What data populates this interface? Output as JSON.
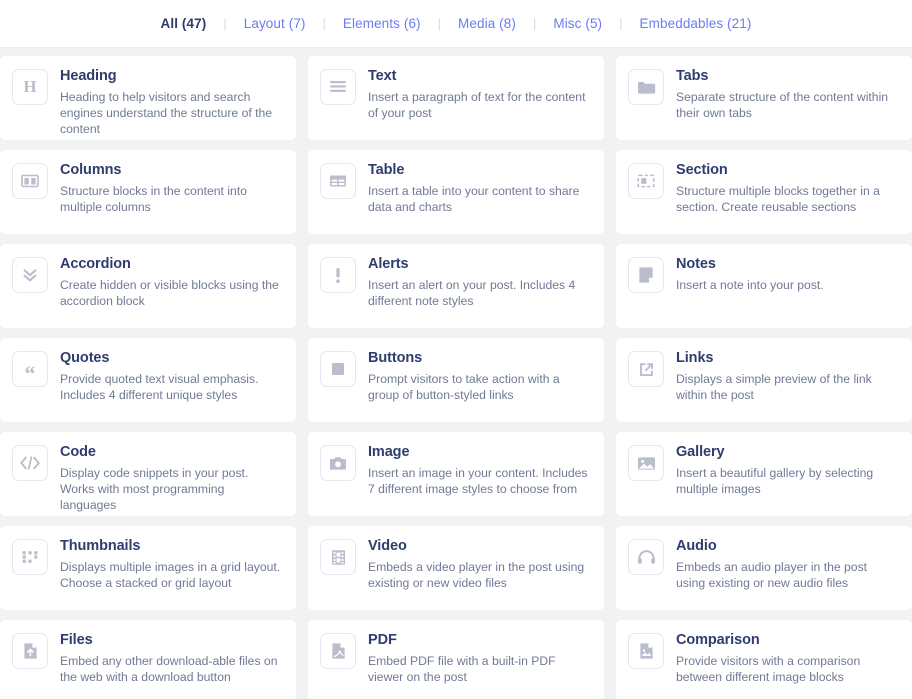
{
  "filters": {
    "separator": "|",
    "tabs": [
      {
        "label": "All (47)",
        "active": true
      },
      {
        "label": "Layout (7)",
        "active": false
      },
      {
        "label": "Elements (6)",
        "active": false
      },
      {
        "label": "Media (8)",
        "active": false
      },
      {
        "label": "Misc (5)",
        "active": false
      },
      {
        "label": "Embeddables (21)",
        "active": false
      }
    ]
  },
  "colors": {
    "page_background": "#f1f2f4",
    "card_background": "#ffffff",
    "title": "#2f3d6e",
    "description": "#707a94",
    "link": "#6b7cf0",
    "icon": "#b9bdcc",
    "icon_border": "#e6e8ef"
  },
  "blocks": [
    {
      "title": "Heading",
      "desc": "Heading to help visitors and search engines understand the structure of the content",
      "icon": "heading-h-icon"
    },
    {
      "title": "Text",
      "desc": "Insert a paragraph of text for the content of your post",
      "icon": "text-lines-icon"
    },
    {
      "title": "Tabs",
      "desc": "Separate structure of the content within their own tabs",
      "icon": "tabs-folder-icon"
    },
    {
      "title": "Columns",
      "desc": "Structure blocks in the content into multiple columns",
      "icon": "columns-icon"
    },
    {
      "title": "Table",
      "desc": "Insert a table into your content to share data and charts",
      "icon": "table-grid-icon"
    },
    {
      "title": "Section",
      "desc": "Structure multiple blocks together in a section. Create reusable sections",
      "icon": "section-icon"
    },
    {
      "title": "Accordion",
      "desc": "Create hidden or visible blocks using the accordion block",
      "icon": "chevron-double-down-icon"
    },
    {
      "title": "Alerts",
      "desc": "Insert an alert on your post. Includes 4 different note styles",
      "icon": "exclamation-icon"
    },
    {
      "title": "Notes",
      "desc": "Insert a note into your post.",
      "icon": "note-page-icon"
    },
    {
      "title": "Quotes",
      "desc": "Provide quoted text visual emphasis. Includes 4 different unique styles",
      "icon": "quote-marks-icon"
    },
    {
      "title": "Buttons",
      "desc": "Prompt visitors to take action with a group of button-styled links",
      "icon": "button-square-icon"
    },
    {
      "title": "Links",
      "desc": "Displays a simple preview of the link within the post",
      "icon": "external-link-icon"
    },
    {
      "title": "Code",
      "desc": "Display code snippets in your post. Works with most programming languages",
      "icon": "code-brackets-icon"
    },
    {
      "title": "Image",
      "desc": "Insert an image in your content. Includes 7 different image styles to choose from",
      "icon": "camera-icon"
    },
    {
      "title": "Gallery",
      "desc": "Insert a beautiful gallery by selecting multiple images",
      "icon": "gallery-picture-icon"
    },
    {
      "title": "Thumbnails",
      "desc": "Displays multiple images in a grid layout. Choose a stacked or grid layout",
      "icon": "thumbnail-dots-icon"
    },
    {
      "title": "Video",
      "desc": "Embeds a video player in the post using existing or new video files",
      "icon": "film-strip-icon"
    },
    {
      "title": "Audio",
      "desc": "Embeds an audio player in the post using existing or new audio files",
      "icon": "headphones-icon"
    },
    {
      "title": "Files",
      "desc": "Embed any other download-able files on the web with a download button",
      "icon": "file-upload-icon"
    },
    {
      "title": "PDF",
      "desc": "Embed PDF file with a built-in PDF viewer on the post",
      "icon": "pdf-file-icon"
    },
    {
      "title": "Comparison",
      "desc": "Provide visitors with a comparison between different image blocks",
      "icon": "comparison-image-icon"
    }
  ]
}
